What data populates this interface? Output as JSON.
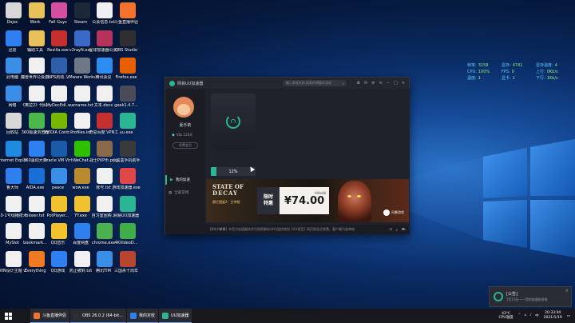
{
  "desktop_icons": [
    {
      "label": "Dojoc",
      "color": "#d8d8d8"
    },
    {
      "label": "Work",
      "color": "#e8c15a"
    },
    {
      "label": "Fall Guys",
      "color": "#d54fa0"
    },
    {
      "label": "Steam",
      "color": "#1b2838"
    },
    {
      "label": "公会信息.txt",
      "color": "#f0f0f0"
    },
    {
      "label": "斗鱼直播伴侣",
      "color": "#f5722d"
    },
    {
      "label": "迅雷",
      "color": "#2e7ff0"
    },
    {
      "label": "辅助工具",
      "color": "#e8c15a"
    },
    {
      "label": "Rezilla.exe",
      "color": "#c62f2f"
    },
    {
      "label": "v2rayN.exe",
      "color": "#3b69c9"
    },
    {
      "label": "星球加速器公会激活1027.zip",
      "color": "#b5335a"
    },
    {
      "label": "OBS Studio",
      "color": "#302e31"
    },
    {
      "label": "此电脑",
      "color": "#3a8ee6"
    },
    {
      "label": "魔兽世界公会激活1027",
      "color": "#f0f0f0"
    },
    {
      "label": "NPS启动...",
      "color": "#2e5fa8"
    },
    {
      "label": "VMware Workstati...",
      "color": "#6d7785"
    },
    {
      "label": "腾讯会议",
      "color": "#2e8bf0"
    },
    {
      "label": "Firefox.exe",
      "color": "#e66000"
    },
    {
      "label": "网络",
      "color": "#3a8ee6"
    },
    {
      "label": "《奥拉2》代码.docx",
      "color": "#f0f0f0"
    },
    {
      "label": "MyDocEdi...",
      "color": "#f0f0f0"
    },
    {
      "label": "warname.txt",
      "color": "#f0f0f0"
    },
    {
      "label": "文本.docx",
      "color": "#f0f0f0"
    },
    {
      "label": "geek1.4.7...",
      "color": "#4a4a58"
    },
    {
      "label": "回收站",
      "color": "#d8d8d8"
    },
    {
      "label": "360极速浏览器",
      "color": "#4cb84c"
    },
    {
      "label": "NVIDIA Contr...",
      "color": "#76b900"
    },
    {
      "label": "Profiles.ini",
      "color": "#f0f0f0"
    },
    {
      "label": "奇思百度 VPN工具...",
      "color": "#c62f2f"
    },
    {
      "label": "uu.exe",
      "color": "#2bb593"
    },
    {
      "label": "Internet Explorer",
      "color": "#1e8ae0"
    },
    {
      "label": "360驱动大师",
      "color": "#2e7ff0"
    },
    {
      "label": "Oracle VM VirtualBox",
      "color": "#1a5aa8"
    },
    {
      "label": "WeChat",
      "color": "#2dc100"
    },
    {
      "label": "战士PVP币.png",
      "color": "#8a6a4a"
    },
    {
      "label": "小黑盒手机助手",
      "color": "#3a3a3a"
    },
    {
      "label": "鲁大师",
      "color": "#2e7ff0"
    },
    {
      "label": "AIDA.exe",
      "color": "#1a6fd6"
    },
    {
      "label": "peace",
      "color": "#3a8ee6"
    },
    {
      "label": "wow.exe",
      "color": "#b98a2e"
    },
    {
      "label": "账号.txt",
      "color": "#f0f0f0"
    },
    {
      "label": "游戏加速器.exe",
      "color": "#e04848"
    },
    {
      "label": "10-1号绿播技术.txt",
      "color": "#f0f0f0"
    },
    {
      "label": "bloxer.txt",
      "color": "#f0f0f0"
    },
    {
      "label": "PotPlayer...",
      "color": "#f2c12e"
    },
    {
      "label": "YY.exe",
      "color": "#f2c12e"
    },
    {
      "label": "自习室团购...",
      "color": "#f0f0f0"
    },
    {
      "label": "网易UU加速器",
      "color": "#2bb593"
    },
    {
      "label": "MySlot",
      "color": "#f0f0f0"
    },
    {
      "label": "bookmark...",
      "color": "#f0f0f0"
    },
    {
      "label": "QQ音乐",
      "color": "#f2c12e"
    },
    {
      "label": "百度网盘",
      "color": "#2e7ff0"
    },
    {
      "label": "chrome.exe",
      "color": "#4caf50"
    },
    {
      "label": "4KVideoD...",
      "color": "#3fae4a"
    },
    {
      "label": "WIN设计主题 v3.2绿色版",
      "color": "#f0f0f0"
    },
    {
      "label": "Everything",
      "color": "#f07a22"
    },
    {
      "label": "QQ游戏",
      "color": "#2e7ff0"
    },
    {
      "label": "防止被封.txt",
      "color": "#f0f0f0"
    },
    {
      "label": "腾讯TIM",
      "color": "#3a8ee6"
    },
    {
      "label": "三国杀十周年",
      "color": "#b8452f"
    }
  ],
  "perf_overlay": {
    "rows": [
      [
        {
          "k": "帧率:",
          "v": "3158"
        },
        {
          "k": "显存:",
          "v": "4741"
        },
        {
          "k": "显存温度:",
          "v": "4"
        }
      ],
      [
        {
          "k": "CPU:",
          "v": "100%"
        },
        {
          "k": "FPS:",
          "v": "0"
        },
        {
          "k": "上行:",
          "v": "0Kb/s"
        }
      ],
      [
        {
          "k": "温度:",
          "v": "1"
        },
        {
          "k": "显卡:",
          "v": "1"
        },
        {
          "k": "下行:",
          "v": "1Kb/s"
        }
      ]
    ]
  },
  "app": {
    "title": "网易UU加速器",
    "search_placeholder": "输入游戏名称,搜索你想要的游戏",
    "title_icons": [
      "gift-icon",
      "message-icon",
      "settings-icon",
      "menu-icon",
      "minimize-icon",
      "maximize-icon",
      "close-icon"
    ],
    "user": {
      "name": "夏乐莉",
      "vip_text": "Vits 120天",
      "member_button": "续费会员"
    },
    "nav": [
      {
        "label": "我的加速",
        "active": true
      },
      {
        "label": "全部游戏",
        "active": false
      }
    ],
    "progress": {
      "value": 0.12,
      "label": "12%"
    },
    "banner": {
      "title_line1": "STATE OF",
      "title_line2": "DECAY",
      "subtitle": "腐烂国度2：主宰版",
      "sale_tag_line1": "限时",
      "sale_tag_line2": "特惠",
      "price": "¥74.00",
      "old_price": "¥99.00",
      "brand": "风暴游戏"
    },
    "status": {
      "tip_prefix": "[UU小掌事]",
      "tip_text": "本官方加速器技术为独家解析(UU)监控收到",
      "tip_link": "[UU规范]",
      "tip_suffix": "网页版会员续费，客户端为准商城",
      "right_icons": [
        "headset-icon",
        "download-icon",
        "cart-icon"
      ]
    }
  },
  "notification": {
    "title": "[公告]",
    "text": "1月13日——您的加速前进啦",
    "close": "×"
  },
  "taskbar": {
    "tasks": [
      {
        "label": "斗鱼直播伴侣",
        "color": "#f5722d"
      },
      {
        "label": "OBS 26.0.2 (64-bit...",
        "color": "#302e31"
      },
      {
        "label": "我的定收",
        "color": "#2e7ff0"
      },
      {
        "label": "UU加速器",
        "color": "#2bb593"
      }
    ],
    "weather_temp": "43℃",
    "weather_text": "CPU温度",
    "time": "20:33:04",
    "date": "2021/1/19"
  }
}
